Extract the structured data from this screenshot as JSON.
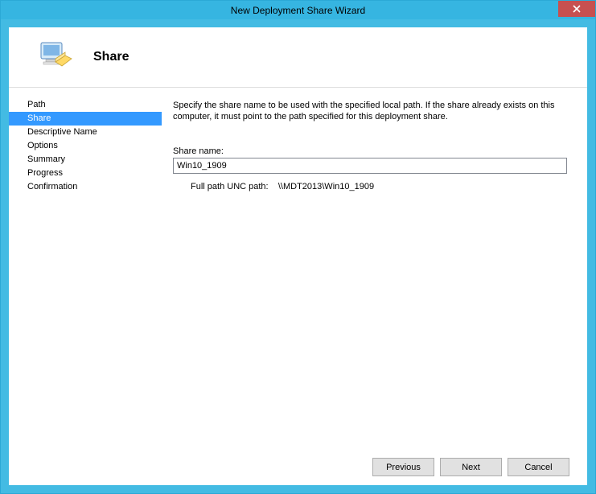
{
  "window": {
    "title": "New Deployment Share Wizard",
    "close": "✕"
  },
  "header": {
    "title": "Share"
  },
  "sidebar": {
    "items": [
      {
        "label": "Path",
        "selected": false
      },
      {
        "label": "Share",
        "selected": true
      },
      {
        "label": "Descriptive Name",
        "selected": false
      },
      {
        "label": "Options",
        "selected": false
      },
      {
        "label": "Summary",
        "selected": false
      },
      {
        "label": "Progress",
        "selected": false
      },
      {
        "label": "Confirmation",
        "selected": false
      }
    ]
  },
  "main": {
    "instructions": "Specify the share name to be used with the specified local path.  If the share already exists on this computer, it must point to the path specified for this deployment share.",
    "share_name_label": "Share name:",
    "share_name_value": "Win10_1909",
    "unc_label": "Full path UNC path:",
    "unc_value": "\\\\MDT2013\\Win10_1909"
  },
  "buttons": {
    "previous": "Previous",
    "next": "Next",
    "cancel": "Cancel"
  }
}
